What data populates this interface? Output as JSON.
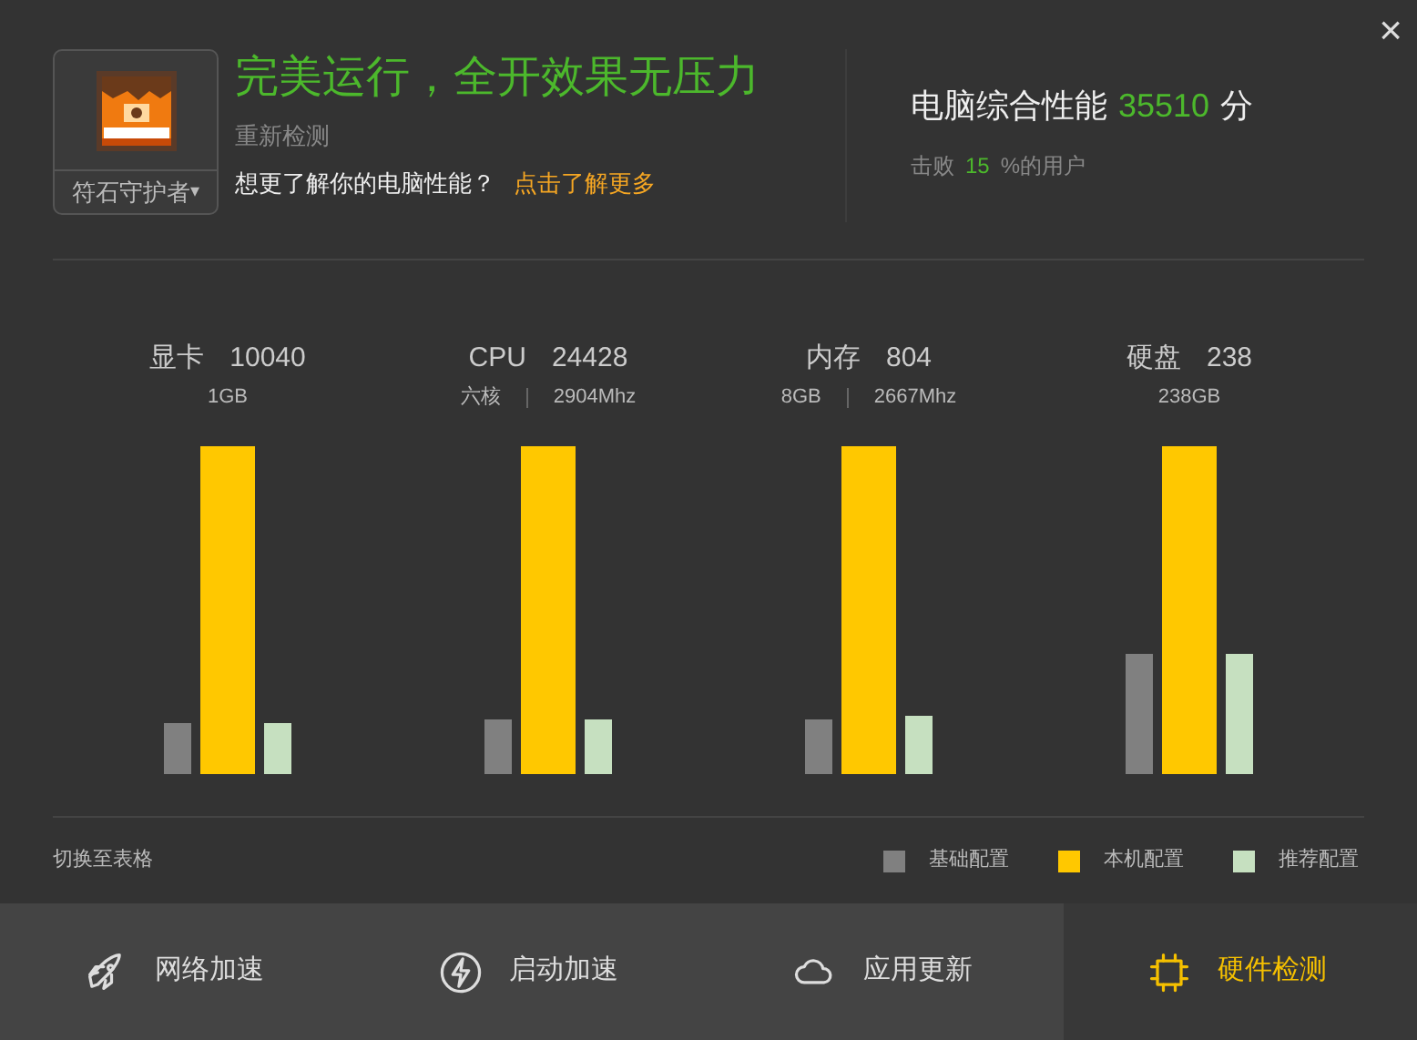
{
  "profile": {
    "badge_name": "符石守护者",
    "caret": "▾"
  },
  "headline": "完美运行，全开效果无压力",
  "recheck_link": "重新检测",
  "prompt": {
    "text": "想更了解你的电脑性能？",
    "link": "点击了解更多"
  },
  "score": {
    "label": "电脑综合性能",
    "value": "35510",
    "unit": "分",
    "beat_prefix": "击败",
    "beat_value": "15",
    "beat_suffix": "%的用户"
  },
  "close": "×",
  "components": [
    {
      "name": "显卡",
      "score": "10040",
      "specs": [
        "1GB"
      ],
      "bars": [
        {
          "kind": "base"
        },
        {
          "kind": "local"
        },
        {
          "kind": "recommended"
        }
      ]
    },
    {
      "name": "CPU",
      "score": "24428",
      "specs": [
        "六核",
        "2904Mhz"
      ],
      "bars": [
        {
          "kind": "base"
        },
        {
          "kind": "local"
        },
        {
          "kind": "recommended"
        }
      ]
    },
    {
      "name": "内存",
      "score": "804",
      "specs": [
        "8GB",
        "2667Mhz"
      ],
      "bars": [
        {
          "kind": "base"
        },
        {
          "kind": "local"
        },
        {
          "kind": "recommended"
        }
      ]
    },
    {
      "name": "硬盘",
      "score": "238",
      "specs": [
        "238GB"
      ],
      "bars": [
        {
          "kind": "base"
        },
        {
          "kind": "local"
        },
        {
          "kind": "recommended"
        }
      ]
    }
  ],
  "switch_view": "切换至表格",
  "legend": [
    {
      "label": "基础配置",
      "color": "#808080"
    },
    {
      "label": "本机配置",
      "color": "#ffc800"
    },
    {
      "label": "推荐配置",
      "color": "#c6e0c0"
    }
  ],
  "bottom_tabs": [
    {
      "kind": "rocket",
      "label": "网络加速",
      "selected": false
    },
    {
      "kind": "bolt",
      "label": "启动加速",
      "selected": false
    },
    {
      "kind": "update",
      "label": "应用更新",
      "selected": false
    },
    {
      "kind": "hardware",
      "label": "硬件检测",
      "selected": true
    }
  ]
}
